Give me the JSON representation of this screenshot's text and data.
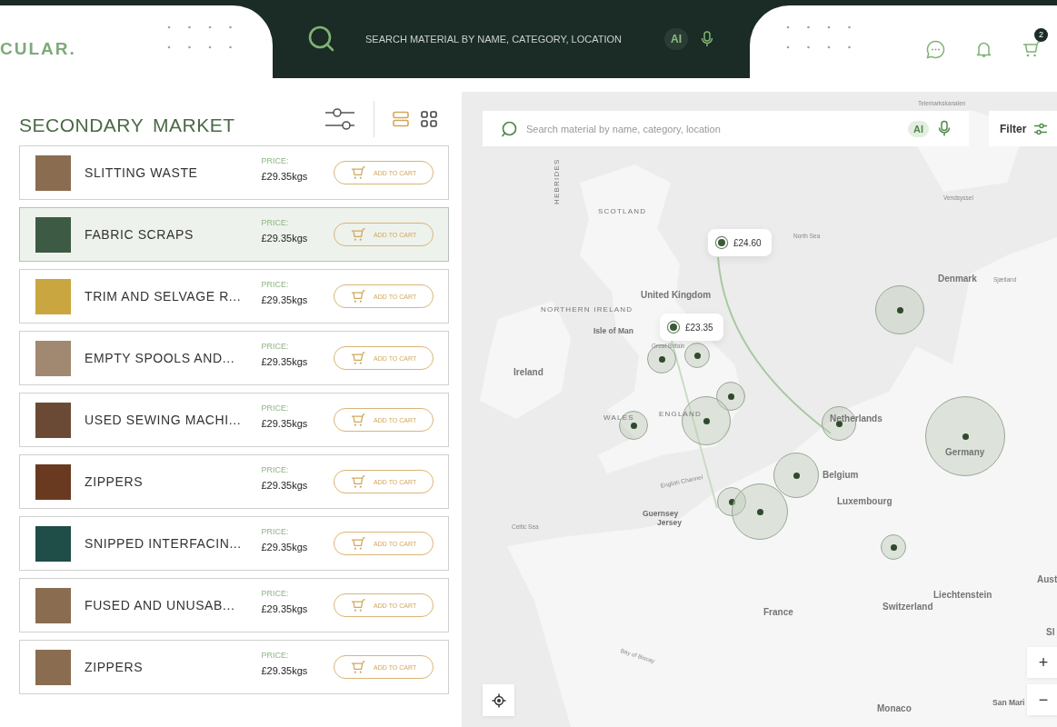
{
  "header": {
    "logo_text": "CULAR.",
    "search_placeholder": "SEARCH MATERIAL BY NAME, CATEGORY, LOCATION",
    "ai_label": "AI",
    "cart_count": "2"
  },
  "market": {
    "title": "SECONDARY MARKET",
    "views": [
      {
        "kind": "list",
        "selected": true
      },
      {
        "kind": "grid",
        "selected": false
      }
    ],
    "items": [
      {
        "name": "SLITTING WASTE",
        "price_label": "PRICE:",
        "price": "£29.35kgs",
        "button": "ADD TO CART",
        "selected": false
      },
      {
        "name": "FABRIC SCRAPS",
        "price_label": "PRICE:",
        "price": "£29.35kgs",
        "button": "ADD TO CART",
        "selected": true
      },
      {
        "name": "TRIM AND SELVAGE R...",
        "price_label": "PRICE:",
        "price": "£29.35kgs",
        "button": "ADD TO CART",
        "selected": false
      },
      {
        "name": "EMPTY SPOOLS AND...",
        "price_label": "PRICE:",
        "price": "£29.35kgs",
        "button": "ADD TO CART",
        "selected": false
      },
      {
        "name": "USED SEWING MACHI...",
        "price_label": "PRICE:",
        "price": "£29.35kgs",
        "button": "ADD TO CART",
        "selected": false
      },
      {
        "name": "ZIPPERS",
        "price_label": "PRICE:",
        "price": "£29.35kgs",
        "button": "ADD TO CART",
        "selected": false
      },
      {
        "name": "SNIPPED INTERFACIN...",
        "price_label": "PRICE:",
        "price": "£29.35kgs",
        "button": "ADD TO CART",
        "selected": false
      },
      {
        "name": "FUSED AND UNUSAB...",
        "price_label": "PRICE:",
        "price": "£29.35kgs",
        "button": "ADD TO CART",
        "selected": false
      },
      {
        "name": "ZIPPERS",
        "price_label": "PRICE:",
        "price": "£29.35kgs",
        "button": "ADD TO CART",
        "selected": false
      }
    ]
  },
  "map": {
    "search_placeholder": "Search material by name, category, location",
    "ai_label": "AI",
    "filter_label": "Filter",
    "labels": [
      {
        "text": "Telemarkskanalen",
        "kind": "sea"
      },
      {
        "text": "HEBRIDES",
        "kind": "region"
      },
      {
        "text": "SCOTLAND",
        "kind": "region"
      },
      {
        "text": "North Sea",
        "kind": "sea"
      },
      {
        "text": "Vendsyssel",
        "kind": "sea"
      },
      {
        "text": "Denmark",
        "kind": "country"
      },
      {
        "text": "Sjælland",
        "kind": "sea"
      },
      {
        "text": "United Kingdom",
        "kind": "country"
      },
      {
        "text": "NORTHERN IRELAND",
        "kind": "region"
      },
      {
        "text": "Isle of Man",
        "kind": "city"
      },
      {
        "text": "Great Britain",
        "kind": "sea"
      },
      {
        "text": "Ireland",
        "kind": "country"
      },
      {
        "text": "WALES",
        "kind": "region"
      },
      {
        "text": "ENGLAND",
        "kind": "region"
      },
      {
        "text": "Netherlands",
        "kind": "country"
      },
      {
        "text": "Germany",
        "kind": "country"
      },
      {
        "text": "Belgium",
        "kind": "country"
      },
      {
        "text": "English Channel",
        "kind": "sea"
      },
      {
        "text": "Luxembourg",
        "kind": "country"
      },
      {
        "text": "Guernsey",
        "kind": "city"
      },
      {
        "text": "Jersey",
        "kind": "city"
      },
      {
        "text": "Celtic Sea",
        "kind": "sea"
      },
      {
        "text": "France",
        "kind": "country"
      },
      {
        "text": "Liechtenstein",
        "kind": "country"
      },
      {
        "text": "Switzerland",
        "kind": "country"
      },
      {
        "text": "Aust",
        "kind": "country"
      },
      {
        "text": "Sl",
        "kind": "country"
      },
      {
        "text": "Bay of Biscay",
        "kind": "sea"
      },
      {
        "text": "Monaco",
        "kind": "country"
      },
      {
        "text": "San Mari",
        "kind": "city"
      }
    ],
    "pins": [
      {
        "price": "£24.60"
      },
      {
        "price": "£23.35"
      }
    ],
    "zoom_in": "+",
    "zoom_out": "−"
  }
}
